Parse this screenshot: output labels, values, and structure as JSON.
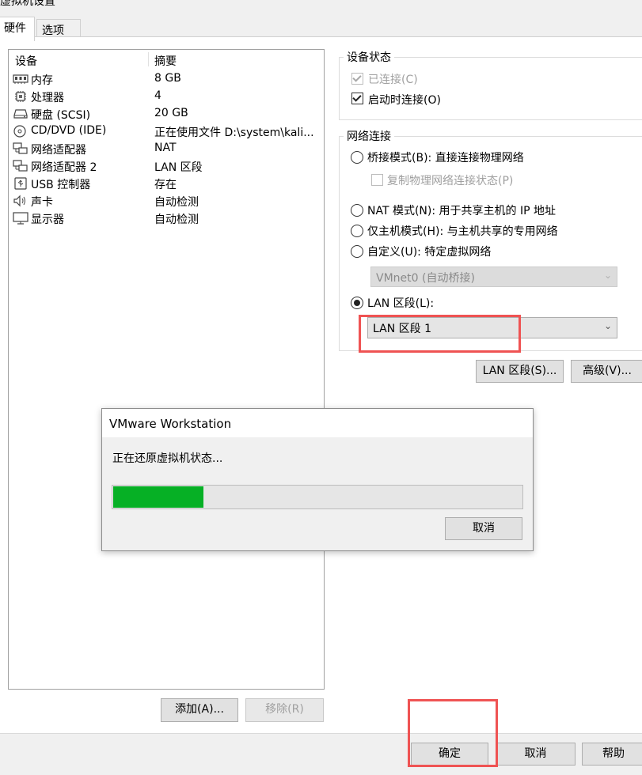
{
  "window": {
    "title_fragment": "虚拟机设置"
  },
  "tabs": [
    {
      "label": "硬件"
    },
    {
      "label": "选项"
    }
  ],
  "device_list": {
    "headers": {
      "device": "设备",
      "summary": "摘要"
    },
    "items": [
      {
        "icon": "memory-icon",
        "name": "内存",
        "summary": "8 GB"
      },
      {
        "icon": "cpu-icon",
        "name": "处理器",
        "summary": "4"
      },
      {
        "icon": "disk-icon",
        "name": "硬盘 (SCSI)",
        "summary": "20 GB"
      },
      {
        "icon": "cd-icon",
        "name": "CD/DVD (IDE)",
        "summary": "正在使用文件 D:\\system\\kali..."
      },
      {
        "icon": "network-icon",
        "name": "网络适配器",
        "summary": "NAT"
      },
      {
        "icon": "network-icon",
        "name": "网络适配器 2",
        "summary": "LAN 区段"
      },
      {
        "icon": "usb-icon",
        "name": "USB 控制器",
        "summary": "存在"
      },
      {
        "icon": "speaker-icon",
        "name": "声卡",
        "summary": "自动检测"
      },
      {
        "icon": "monitor-icon",
        "name": "显示器",
        "summary": "自动检测"
      }
    ],
    "add_label": "添加(A)...",
    "remove_label": "移除(R)"
  },
  "device_status": {
    "title": "设备状态",
    "connected_label": "已连接(C)",
    "connected_checked": true,
    "connect_on_power_label": "启动时连接(O)",
    "connect_on_power_checked": true
  },
  "network": {
    "title": "网络连接",
    "bridged_label": "桥接模式(B): 直接连接物理网络",
    "replicate_label": "复制物理网络连接状态(P)",
    "nat_label": "NAT 模式(N): 用于共享主机的 IP 地址",
    "hostonly_label": "仅主机模式(H): 与主机共享的专用网络",
    "custom_label": "自定义(U): 特定虚拟网络",
    "custom_value": "VMnet0 (自动桥接)",
    "lan_label": "LAN 区段(L):",
    "lan_value": "LAN 区段 1",
    "selected": "lan"
  },
  "buttons": {
    "lan_segments": "LAN 区段(S)...",
    "advanced": "高级(V)...",
    "ok": "确定",
    "cancel": "取消",
    "help": "帮助"
  },
  "modal": {
    "title": "VMware Workstation",
    "message": "正在还原虚拟机状态...",
    "progress": 0.22,
    "cancel_label": "取消"
  },
  "colors": {
    "progress_fill": "#06b025",
    "highlight_box": "#ef5353"
  }
}
